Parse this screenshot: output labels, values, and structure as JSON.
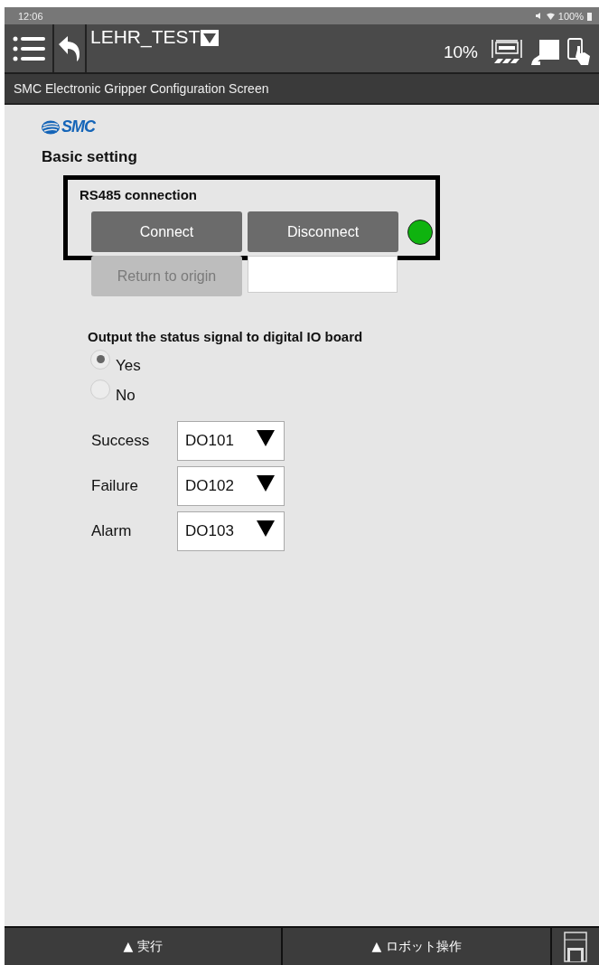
{
  "status_bar": {
    "time": "12:06",
    "battery": "100%"
  },
  "toolbar": {
    "title": "LEHR_TEST",
    "speed": "10%"
  },
  "screen_title": "SMC Electronic Gripper Configuration Screen",
  "logo": "SMC",
  "section_title": "Basic setting",
  "connection": {
    "label": "RS485 connection",
    "buttons": [
      "Connect",
      "Disconnect"
    ],
    "connected": true
  },
  "origin": {
    "button": "Return to origin",
    "disabled": true
  },
  "output": {
    "heading": "Output the status signal to digital IO board",
    "options": [
      {
        "label": "Yes",
        "selected": true
      },
      {
        "label": "No",
        "selected": false
      }
    ],
    "signals": [
      {
        "label": "Success",
        "value": "DO101"
      },
      {
        "label": "Failure",
        "value": "DO102"
      },
      {
        "label": "Alarm",
        "value": "DO103"
      }
    ]
  },
  "bottom_bar": {
    "tabs": [
      "▲ 実行",
      "▲ ロボット操作"
    ]
  }
}
